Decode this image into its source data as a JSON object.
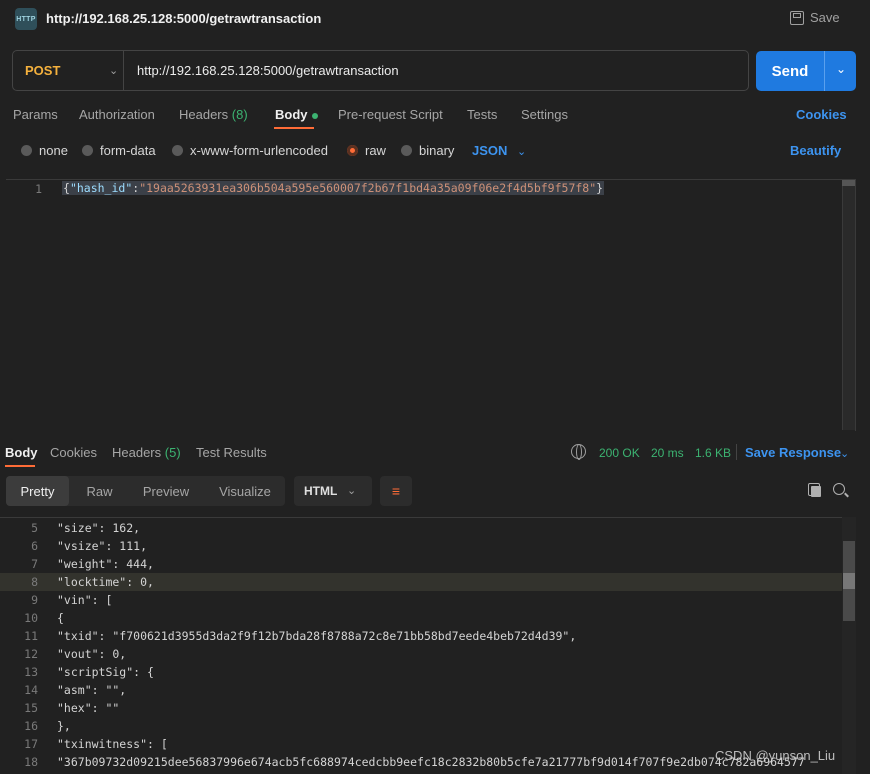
{
  "window": {
    "title": "http://192.168.25.128:5000/getrawtransaction",
    "icon_label": "HTTP",
    "save_label": "Save"
  },
  "request": {
    "method": "POST",
    "url": "http://192.168.25.128:5000/getrawtransaction",
    "send_label": "Send"
  },
  "request_tabs": {
    "params": "Params",
    "authorization": "Authorization",
    "headers": "Headers",
    "headers_count": "(8)",
    "body": "Body",
    "prerequest": "Pre-request Script",
    "tests": "Tests",
    "settings": "Settings",
    "cookies": "Cookies"
  },
  "body_types": {
    "none": "none",
    "form_data": "form-data",
    "urlencoded": "x-www-form-urlencoded",
    "raw": "raw",
    "binary": "binary",
    "format": "JSON",
    "beautify": "Beautify"
  },
  "request_body": {
    "line_number": "1",
    "brace_open": "{",
    "key": "\"hash_id\"",
    "colon": ":",
    "value": "\"19aa5263931ea306b504a595e560007f2b67f1bd4a35a09f06e2f4d5bf9f57f8\"",
    "brace_close": "}"
  },
  "response_tabs": {
    "body": "Body",
    "cookies": "Cookies",
    "headers": "Headers",
    "headers_count": "(5)",
    "test_results": "Test Results"
  },
  "response_status": {
    "status": "200 OK",
    "time": "20 ms",
    "size": "1.6 KB",
    "save_response": "Save Response"
  },
  "response_toolbar": {
    "pretty": "Pretty",
    "raw": "Raw",
    "preview": "Preview",
    "visualize": "Visualize",
    "format": "HTML"
  },
  "response_lines": [
    {
      "n": "5",
      "code": "\"size\": 162,"
    },
    {
      "n": "6",
      "code": "\"vsize\": 111,"
    },
    {
      "n": "7",
      "code": "\"weight\": 444,"
    },
    {
      "n": "8",
      "code": "\"locktime\": 0,"
    },
    {
      "n": "9",
      "code": "\"vin\": ["
    },
    {
      "n": "10",
      "code": "{"
    },
    {
      "n": "11",
      "code": "\"txid\": \"f700621d3955d3da2f9f12b7bda28f8788a72c8e71bb58bd7eede4beb72d4d39\","
    },
    {
      "n": "12",
      "code": "\"vout\": 0,"
    },
    {
      "n": "13",
      "code": "\"scriptSig\": {"
    },
    {
      "n": "14",
      "code": "\"asm\": \"\","
    },
    {
      "n": "15",
      "code": "\"hex\": \"\""
    },
    {
      "n": "16",
      "code": "},"
    },
    {
      "n": "17",
      "code": "\"txinwitness\": ["
    },
    {
      "n": "18",
      "code": "\"367b09732d09215dee56837996e674acb5fc688974cedcbb9eefc18c2832b80b5cfe7a21777bf9d014f707f9e2db074c782a6964577"
    }
  ],
  "watermark": "CSDN @yunson_Liu",
  "colors": {
    "accent_orange": "#ff6c37",
    "link_blue": "#3d94f0",
    "send_blue": "#1f7ae0",
    "status_green": "#3cb371",
    "post_method": "#f5b13d"
  }
}
